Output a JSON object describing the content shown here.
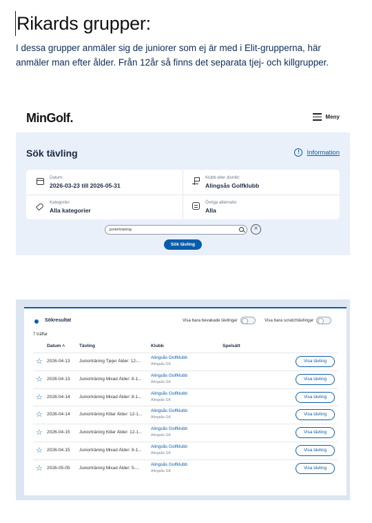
{
  "document": {
    "title": "Rikards grupper:",
    "paragraph": "I dessa grupper anmäler sig de juniorer som ej är med i Elit-grupperna, här anmäler man efter ålder. Från 12år så finns det separata tjej- och killgrupper."
  },
  "screenshot1": {
    "logo": "MinGolf.",
    "menu_label": "Meny",
    "page_title": "Sök tävling",
    "info_link": "Information",
    "filters": {
      "date_label": "Datum:",
      "date_value": "2026-03-23 till 2026-05-31",
      "club_label": "Klubb eller distrikt:",
      "club_value": "Alingsås Golfklubb",
      "category_label": "Kategorier:",
      "category_value": "Alla kategorier",
      "other_label": "Övriga alternativ:",
      "other_value": "Alla"
    },
    "search_value": "juniorträning",
    "search_button": "Sök tävling"
  },
  "screenshot2": {
    "results_title": "Sökresultat",
    "toggle_watched": "Visa bara bevakade tävlingar",
    "toggle_scratch": "Visa bara scratchtävlingar",
    "hits": "7 träffar",
    "columns": {
      "date": "Datum ˄",
      "competition": "Tävling",
      "club": "Klubb",
      "format": "Spelsätt"
    },
    "rows": [
      {
        "date": "2026-04-13",
        "name": "Juniorträning Tjejer Ålder: 12-...",
        "club": "Alingsås Golfklubb",
        "district": "Alingsås GK",
        "button": "Visa tävling"
      },
      {
        "date": "2026-04-13",
        "name": "Juniorträning Mixad Ålder: 8-1...",
        "club": "Alingsås Golfklubb",
        "district": "Alingsås GK",
        "button": "Visa tävling"
      },
      {
        "date": "2026-04-14",
        "name": "Juniorträning Mixad Ålder: 8-1...",
        "club": "Alingsås Golfklubb",
        "district": "Alingsås GK",
        "button": "Visa tävling"
      },
      {
        "date": "2026-04-14",
        "name": "Juniorträning Killar Ålder: 12-1...",
        "club": "Alingsås Golfklubb",
        "district": "Alingsås GK",
        "button": "Visa tävling"
      },
      {
        "date": "2026-04-15",
        "name": "Juniorträning Killar Ålder: 12-1...",
        "club": "Alingsås Golfklubb",
        "district": "Alingsås GK",
        "button": "Visa tävling"
      },
      {
        "date": "2026-04-15",
        "name": "Juniorträning Mixad Ålder: 8-1...",
        "club": "Alingsås Golfklubb",
        "district": "Alingsås GK",
        "button": "Visa tävling"
      },
      {
        "date": "2026-05-05",
        "name": "Juniorträning Mixad Ålder: 5-...",
        "club": "Alingsås Golfklubb",
        "district": "Alingsås GK",
        "button": "Visa tävling"
      }
    ]
  }
}
